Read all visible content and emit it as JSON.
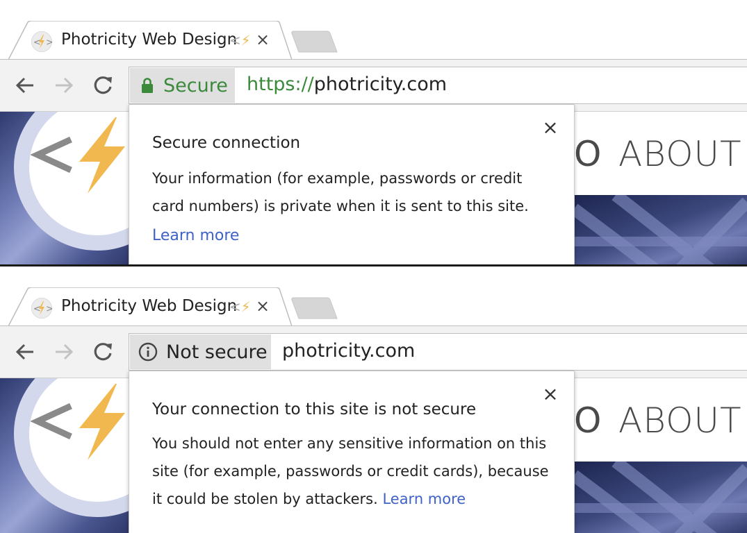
{
  "panels": [
    {
      "tab": {
        "title": "Photricity Web Design",
        "fade_text": "<",
        "fade_bolt": "⚡",
        "close_glyph": "×"
      },
      "toolbar": {
        "back_label": "Back",
        "forward_label": "Forward",
        "reload_label": "Reload"
      },
      "omnibox": {
        "security_label": "Secure",
        "security_icon": "lock-icon",
        "url_scheme": "https://",
        "url_host": "photricity.com"
      },
      "page": {
        "nav_partial": "O",
        "nav_about": "ABOUT"
      },
      "bubble": {
        "title": "Secure connection",
        "body": "Your information (for example, passwords or credit card numbers) is private when it is sent to this site.",
        "link": "Learn more",
        "close_glyph": "×"
      }
    },
    {
      "tab": {
        "title": "Photricity Web Design",
        "fade_text": "<",
        "fade_bolt": "⚡",
        "close_glyph": "×"
      },
      "toolbar": {
        "back_label": "Back",
        "forward_label": "Forward",
        "reload_label": "Reload"
      },
      "omnibox": {
        "security_label": "Not secure",
        "security_icon": "info-icon",
        "url_host": "photricity.com"
      },
      "page": {
        "nav_partial": "O",
        "nav_about": "ABOUT"
      },
      "bubble": {
        "title": "Your connection to this site is not secure",
        "body": "You should not enter any sensitive information on this site (for example, passwords or credit cards), because it could be stolen by attackers.",
        "link": "Learn more",
        "close_glyph": "×"
      }
    }
  ],
  "colors": {
    "secure_green": "#3b8a3c",
    "link_blue": "#3f62c7",
    "bolt_orange": "#f0b84f",
    "chip_gray": "#e0e0e0"
  }
}
